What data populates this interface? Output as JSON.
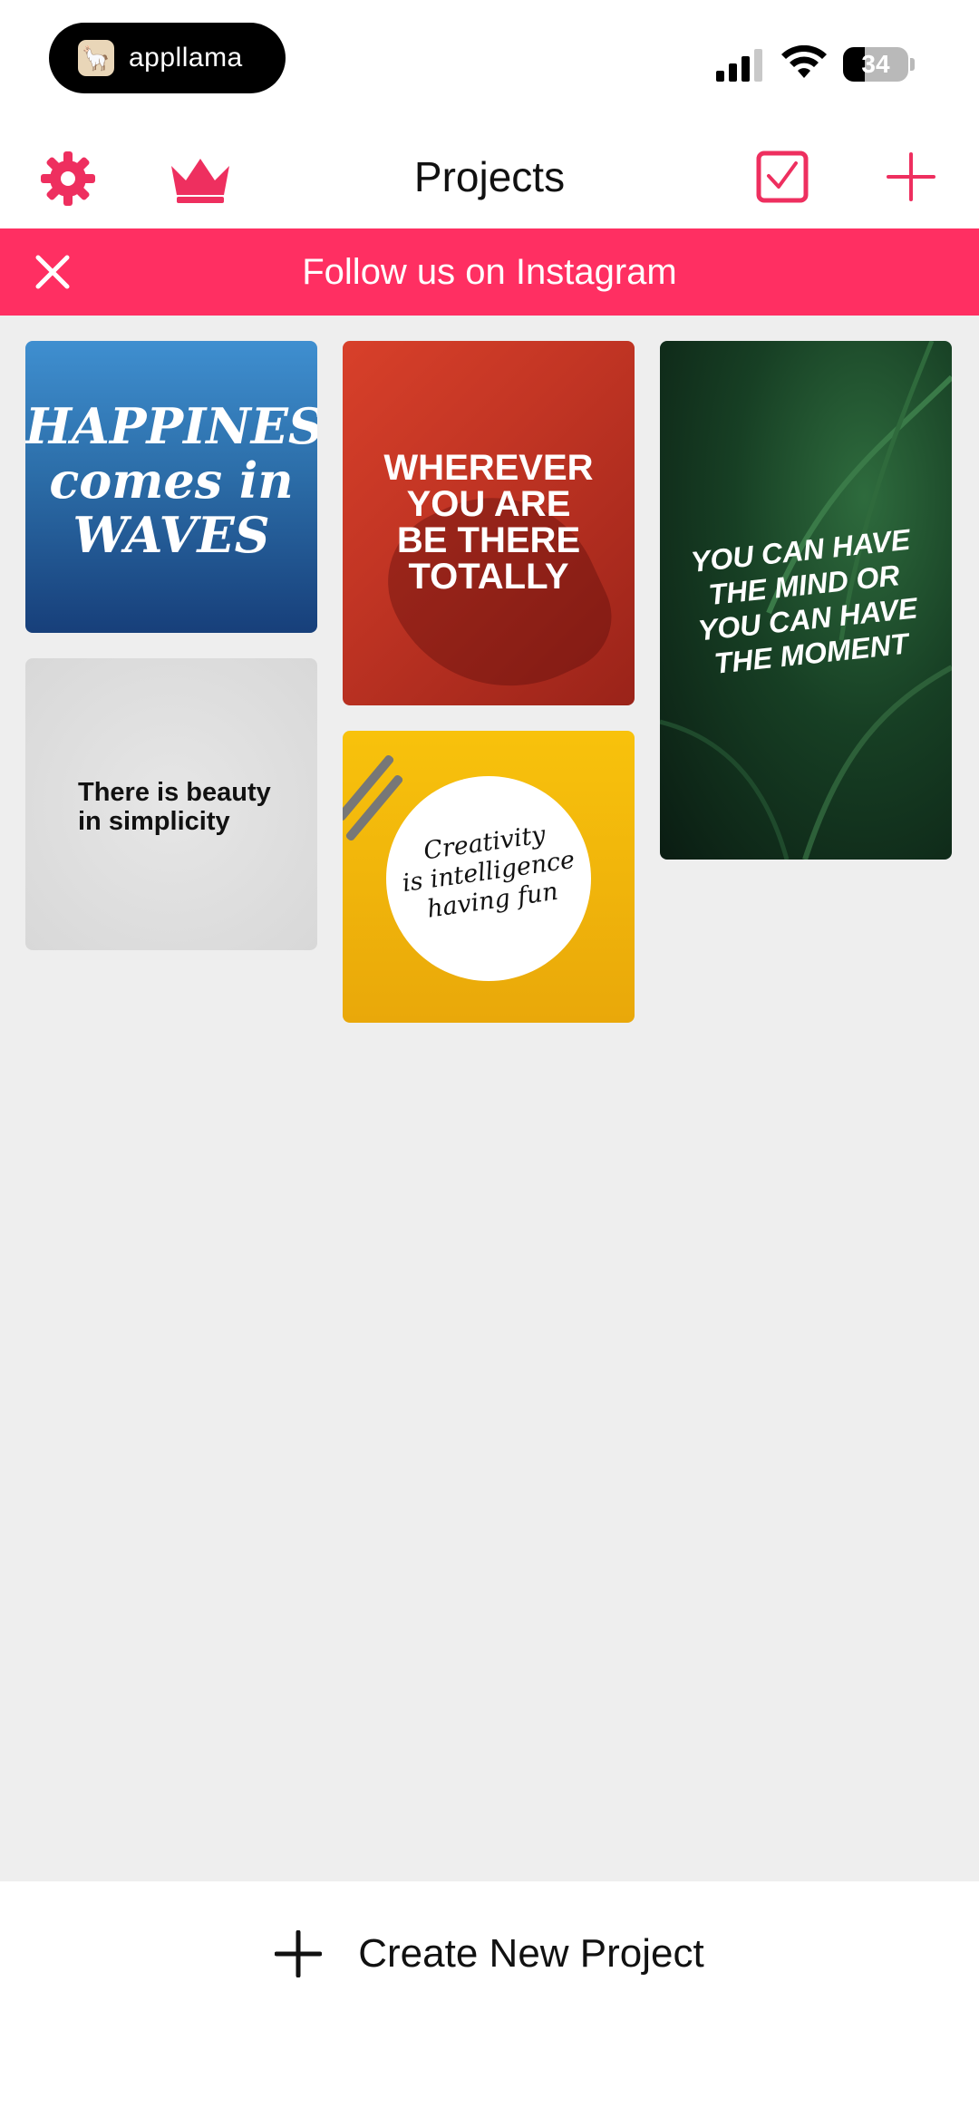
{
  "status_bar": {
    "app_pill_text": "appllama",
    "battery_percent": "34",
    "battery_level": 0.34
  },
  "nav": {
    "title": "Projects",
    "icons": [
      "gear-icon",
      "crown-icon",
      "checkbox-icon",
      "plus-icon"
    ]
  },
  "banner": {
    "text": "Follow us on Instagram",
    "icon": "close-icon"
  },
  "projects": [
    {
      "text": "HAPPINESS\ncomes in\nWAVES"
    },
    {
      "text": "WHEREVER\nYOU ARE\nBE THERE\nTOTALLY"
    },
    {
      "text": "YOU CAN HAVE\nTHE MIND OR\nYOU CAN HAVE\nTHE MOMENT"
    },
    {
      "text": "There is beauty\nin simplicity"
    },
    {
      "text": "Creativity\nis intelligence\nhaving fun"
    }
  ],
  "bottom": {
    "create_label": "Create New Project",
    "icon": "plus-icon"
  },
  "colors": {
    "accent": "#ff2f62",
    "grid_background": "#eeeeee"
  }
}
